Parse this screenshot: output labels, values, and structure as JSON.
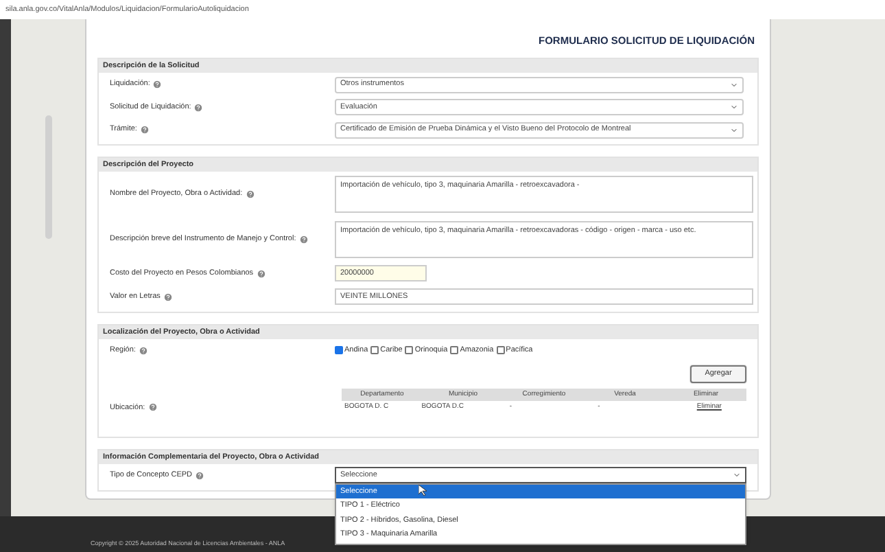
{
  "address_bar": {
    "url": "sila.anla.gov.co/VitalAnla/Modulos/Liquidacion/FormularioAutoliquidacion"
  },
  "form": {
    "title": "FORMULARIO SOLICITUD DE LIQUIDACIÓN",
    "sections": [
      {
        "title": "Descripción de la Solicitud",
        "fields": [
          {
            "kind": "select",
            "label": "Liquidación:",
            "value": "Otros instrumentos"
          },
          {
            "kind": "select",
            "label": "Solicitud de Liquidación:",
            "value": "Evaluación"
          },
          {
            "kind": "select",
            "label": "Trámite:",
            "value": "Certificado de Emisión de Prueba Dinámica y el Visto Bueno del Protocolo de Montreal"
          }
        ]
      },
      {
        "title": "Descripción del Proyecto",
        "fields": [
          {
            "kind": "textarea",
            "label": "Nombre del Proyecto, Obra o Actividad:",
            "value": "Importación de vehículo, tipo 3, maquinaria Amarilla - retroexcavadora -"
          },
          {
            "kind": "textarea",
            "label": "Descripción breve del Instrumento de Manejo y Control:",
            "value": "Importación de vehículo, tipo 3, maquinaria Amarilla - retroexcavadoras - código - origen - marca - uso etc."
          },
          {
            "kind": "short_input",
            "label": "Costo del Proyecto en Pesos Colombianos",
            "value": "20000000"
          },
          {
            "kind": "input",
            "label": "Valor en Letras",
            "value": "VEINTE MILLONES"
          }
        ]
      },
      {
        "title": "Localización del Proyecto, Obra o Actividad",
        "fields": [
          {
            "kind": "checkboxes",
            "label": "Región:",
            "options": [
              {
                "label": "Andina",
                "checked": true
              },
              {
                "label": "Caribe",
                "checked": false
              },
              {
                "label": "Orinoquia",
                "checked": false
              },
              {
                "label": "Amazonia",
                "checked": false
              },
              {
                "label": "Pacífica",
                "checked": false
              }
            ]
          },
          {
            "kind": "table",
            "label": "Ubicación:",
            "button": "Agregar",
            "columns": [
              "Departamento",
              "Municipio",
              "Corregimiento",
              "Vereda",
              "Eliminar"
            ],
            "rows": [
              [
                "BOGOTA D. C",
                "BOGOTA D.C",
                "-",
                "-",
                "Eliminar"
              ]
            ]
          }
        ]
      },
      {
        "title": "Información Complementaria del Proyecto, Obra o Actividad",
        "fields": [
          {
            "kind": "dropdown",
            "label": "Tipo de Concepto CEPD",
            "value": "Seleccione",
            "expanded": true,
            "options": [
              {
                "label": "Seleccione",
                "selected": true
              },
              {
                "label": "TIPO 1 - Eléctrico",
                "selected": false
              },
              {
                "label": "TIPO 2 - Híbridos, Gasolina, Diesel",
                "selected": false
              },
              {
                "label": "TIPO 3 - Maquinaria Amarilla",
                "selected": false
              }
            ]
          }
        ]
      }
    ]
  },
  "footer": {
    "copyright": "Copyright © 2025 Autoridad Nacional de Licencias Ambientales - ANLA"
  }
}
